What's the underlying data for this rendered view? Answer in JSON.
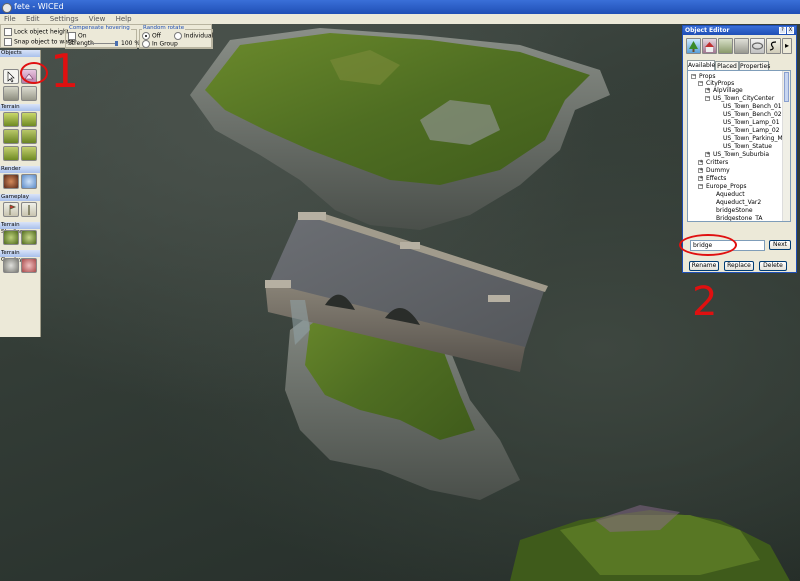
{
  "window": {
    "title": "fete - WICEd"
  },
  "menu": [
    "File",
    "Edit",
    "Settings",
    "View",
    "Help"
  ],
  "toolbar": {
    "lock_height_label": "Lock object height",
    "snap_water_label": "Snap object to water",
    "comp_title": "Compensate hovering",
    "comp_on_label": "On",
    "strength_label": "Strength",
    "strength_value": "100 %",
    "rotate_title": "Random rotate",
    "rot_off_label": "Off",
    "rot_individual_label": "Individual",
    "rot_group_label": "In Group"
  },
  "palette": {
    "sections": [
      "Objects",
      "Terrain",
      "Render",
      "Gameplay",
      "Terrain Shading",
      "Terrain Overlay"
    ]
  },
  "object_editor": {
    "title": "Object Editor",
    "help": "?",
    "close": "X",
    "more": "▸",
    "tabs": [
      "Available",
      "Placed",
      "Properties"
    ],
    "tree": [
      {
        "label": "Props",
        "exp": "−"
      },
      {
        "label": "CityProps",
        "exp": "−"
      },
      {
        "label": "AlpVillage",
        "exp": "+"
      },
      {
        "label": "US_Town_CityCenter",
        "exp": "−"
      },
      {
        "label": "US_Town_Bench_01",
        "exp": ""
      },
      {
        "label": "US_Town_Bench_02",
        "exp": ""
      },
      {
        "label": "US_Town_Lamp_01",
        "exp": ""
      },
      {
        "label": "US_Town_Lamp_02",
        "exp": ""
      },
      {
        "label": "US_Town_Parking_M",
        "exp": ""
      },
      {
        "label": "US_Town_Statue",
        "exp": ""
      },
      {
        "label": "US_Town_Suburbia",
        "exp": "+"
      },
      {
        "label": "Critters",
        "exp": "+"
      },
      {
        "label": "Dummy",
        "exp": "+"
      },
      {
        "label": "Effects",
        "exp": "+"
      },
      {
        "label": "Europe_Props",
        "exp": "−"
      },
      {
        "label": "Aqueduct",
        "exp": ""
      },
      {
        "label": "Aqueduct_Var2",
        "exp": ""
      },
      {
        "label": "bridgeStone",
        "exp": ""
      },
      {
        "label": "Bridgestone_TA",
        "exp": ""
      }
    ],
    "search_value": "bridge",
    "next_label": "Next",
    "rename_label": "Rename",
    "replace_label": "Replace",
    "delete_label": "Delete"
  },
  "annotations": {
    "one": "1",
    "two": "2"
  },
  "colors": {
    "accent": "#1f4fb5",
    "annotation": "#e01010"
  }
}
